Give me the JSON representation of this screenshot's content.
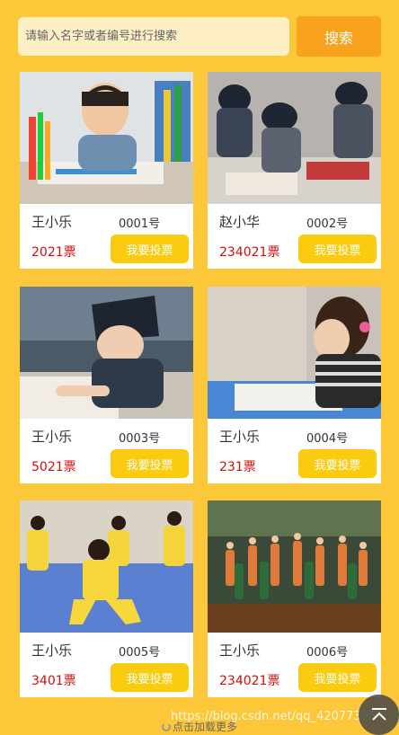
{
  "search": {
    "placeholder": "请输入名字或者编号进行搜索",
    "button_label": "搜索"
  },
  "cards": [
    {
      "name": "王小乐",
      "number": "0001号",
      "votes": "2021票",
      "vote_label": "我要投票",
      "photo": "boy drawing with colored pencils"
    },
    {
      "name": "赵小华",
      "number": "0002号",
      "votes": "234021票",
      "vote_label": "我要投票",
      "photo": "children in caps writing calligraphy"
    },
    {
      "name": "王小乐",
      "number": "0003号",
      "votes": "5021票",
      "vote_label": "我要投票",
      "photo": "boy in cap reading book"
    },
    {
      "name": "王小乐",
      "number": "0004号",
      "votes": "231票",
      "vote_label": "我要投票",
      "photo": "girl writing at desk"
    },
    {
      "name": "王小乐",
      "number": "0005号",
      "votes": "3401票",
      "vote_label": "我要投票",
      "photo": "children in yellow martial arts uniforms"
    },
    {
      "name": "王小乐",
      "number": "0006号",
      "votes": "234021票",
      "vote_label": "我要投票",
      "photo": "children dancing on stage"
    }
  ],
  "footer": {
    "loading_text": "点击加载更多",
    "watermark": "https://blog.csdn.net/qq_42077395"
  },
  "colors": {
    "background": "#fdc73a",
    "search_button": "#f9a21d",
    "vote_button": "#fbcb10",
    "votes_text": "#d40d0d"
  },
  "icons": {
    "back_to_top": "arrow-up-icon",
    "loading": "spinner-icon"
  }
}
